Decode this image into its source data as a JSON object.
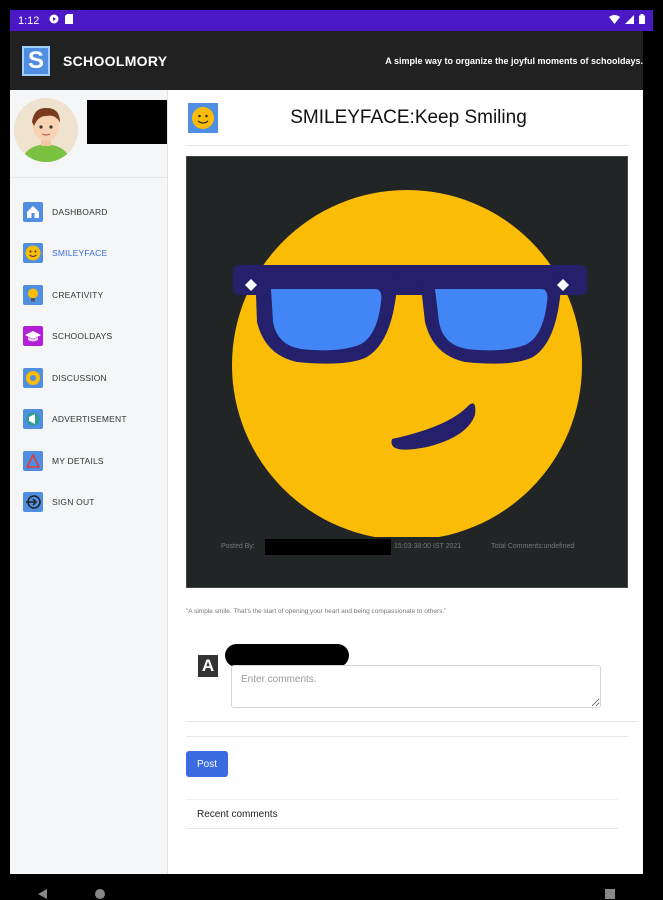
{
  "status_bar": {
    "time": "1:12"
  },
  "app": {
    "logo_letter": "S",
    "name": "SCHOOLMORY",
    "tagline": "A simple way to organize the joyful moments of schooldays."
  },
  "sidebar": {
    "items": [
      {
        "label": "DASHBOARD",
        "icon": "home-icon",
        "active": false
      },
      {
        "label": "SMILEYFACE",
        "icon": "smiley-icon",
        "active": true
      },
      {
        "label": "CREATIVITY",
        "icon": "bulb-icon",
        "active": false
      },
      {
        "label": "SCHOOLDAYS",
        "icon": "graduation-cap-icon",
        "active": false
      },
      {
        "label": "DISCUSSION",
        "icon": "discussion-icon",
        "active": false
      },
      {
        "label": "ADVERTISEMENT",
        "icon": "megaphone-icon",
        "active": false
      },
      {
        "label": "MY DETAILS",
        "icon": "details-icon",
        "active": false
      },
      {
        "label": "SIGN OUT",
        "icon": "sign-out-icon",
        "active": false
      }
    ]
  },
  "main": {
    "title": "SMILEYFACE:Keep Smiling",
    "post": {
      "posted_by_label": "Posted By:",
      "time": "15:03:38:00 IST 2021",
      "total_comments": "Total Comments:undefined"
    },
    "caption": "\"A simple smile. That's the start of opening your heart and being compassionate to others.\"",
    "comment": {
      "avatar_letter": "A",
      "placeholder": "Enter comments."
    },
    "post_button": "Post",
    "recent_comments": "Recent comments"
  },
  "colors": {
    "status_bar": "#4a18c4",
    "app_bar": "#212121",
    "accent": "#3a6be0",
    "smiley_face": "#fbbc05",
    "sunglasses_frame": "#25206b",
    "sunglasses_lens": "#4285f4"
  }
}
